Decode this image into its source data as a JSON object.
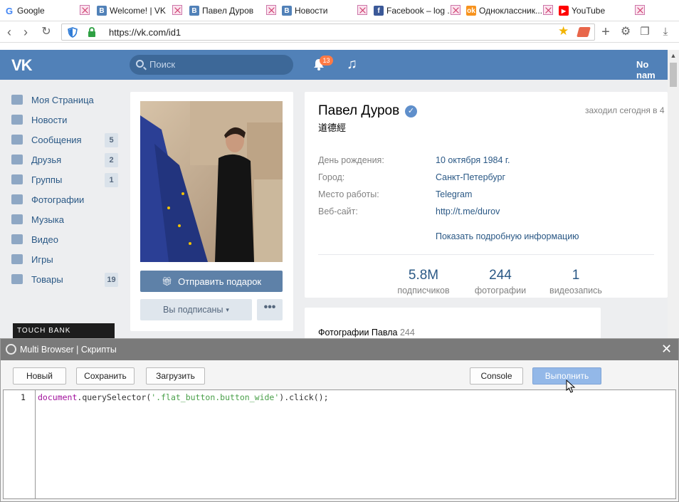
{
  "browser": {
    "tabs": [
      {
        "label": "Google",
        "icon": "google-icon"
      },
      {
        "label": "Welcome! | VK",
        "icon": "vk-icon"
      },
      {
        "label": "Павел Дуров",
        "icon": "vk-icon"
      },
      {
        "label": "Новости",
        "icon": "vk-icon"
      },
      {
        "label": "Facebook – log ...",
        "icon": "facebook-icon"
      },
      {
        "label": "Одноклассник...",
        "icon": "odnoklassniki-icon"
      },
      {
        "label": "YouTube",
        "icon": "youtube-icon"
      }
    ],
    "url": "https://vk.com/id1"
  },
  "vk": {
    "logo": "VK",
    "search_placeholder": "Поиск",
    "notifications_count": "13",
    "user_name": "No nam",
    "menu": [
      {
        "label": "Моя Страница",
        "icon": "home-icon",
        "count": ""
      },
      {
        "label": "Новости",
        "icon": "news-icon",
        "count": ""
      },
      {
        "label": "Сообщения",
        "icon": "messages-icon",
        "count": "5"
      },
      {
        "label": "Друзья",
        "icon": "friends-icon",
        "count": "2"
      },
      {
        "label": "Группы",
        "icon": "groups-icon",
        "count": "1"
      },
      {
        "label": "Фотографии",
        "icon": "camera-icon",
        "count": ""
      },
      {
        "label": "Музыка",
        "icon": "music-icon",
        "count": ""
      },
      {
        "label": "Видео",
        "icon": "video-icon",
        "count": ""
      },
      {
        "label": "Игры",
        "icon": "games-icon",
        "count": ""
      },
      {
        "label": "Товары",
        "icon": "goods-icon",
        "count": "19"
      }
    ],
    "ad_label": "TOUCH BANK",
    "gift_button": "Отправить подарок",
    "subscribed_button": "Вы подписаны",
    "more_button": "•••",
    "profile": {
      "name": "Павел Дуров",
      "status": "道德經",
      "online": "заходил сегодня в 4",
      "info": [
        {
          "label": "День рождения:",
          "value": "10 октября 1984 г."
        },
        {
          "label": "Город:",
          "value": "Санкт-Петербург"
        },
        {
          "label": "Место работы:",
          "value": "Telegram"
        },
        {
          "label": "Веб-сайт:",
          "value": "http://t.me/durov"
        }
      ],
      "more_info": "Показать подробную информацию",
      "stats": [
        {
          "value": "5.8M",
          "label": "подписчиков"
        },
        {
          "value": "244",
          "label": "фотографии"
        },
        {
          "value": "1",
          "label": "видеозапись"
        }
      ],
      "photos_title": "Фотографии Павла",
      "photos_count": "244"
    }
  },
  "scripts_panel": {
    "title": "Multi Browser | Скрипты",
    "buttons": {
      "new": "Новый",
      "save": "Сохранить",
      "load": "Загрузить",
      "console": "Console",
      "run": "Выполнить"
    },
    "line_number": "1",
    "code_keyword": "document",
    "code_part1": ".querySelector(",
    "code_string": "'.flat_button.button_wide'",
    "code_part2": ").click();"
  },
  "colors": {
    "vk_blue": "#5181b8",
    "panel_gray": "#7a7a7a",
    "run_button": "#93b8e8"
  }
}
